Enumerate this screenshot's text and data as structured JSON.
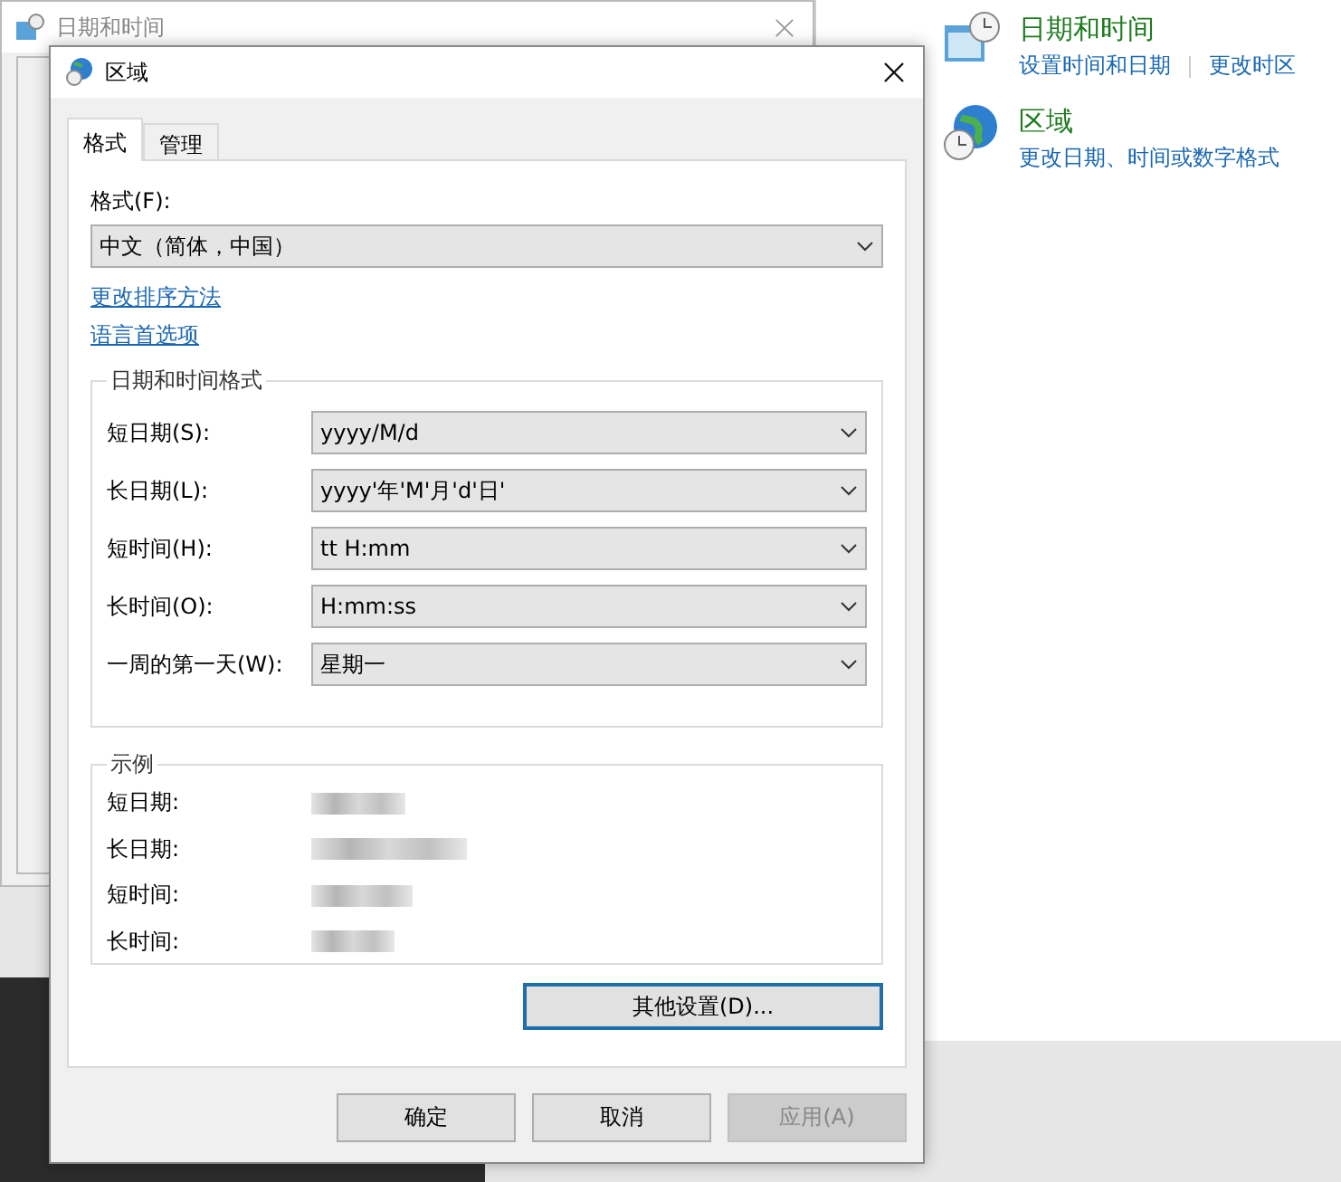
{
  "control_panel": {
    "items": [
      {
        "title": "日期和时间",
        "links": [
          "设置时间和日期",
          "更改时区"
        ]
      },
      {
        "title": "区域",
        "links": [
          "更改日期、时间或数字格式"
        ]
      }
    ]
  },
  "back_window": {
    "title": "日期和时间"
  },
  "dialog": {
    "title": "区域",
    "tabs": [
      {
        "label": "格式",
        "selected": true
      },
      {
        "label": "管理",
        "selected": false
      }
    ],
    "format_label": "格式(F):",
    "format_value": "中文（简体，中国）",
    "links": [
      "更改排序方法",
      "语言首选项"
    ],
    "datetime_group": {
      "title": "日期和时间格式",
      "rows": [
        {
          "label": "短日期(S):",
          "value": "yyyy/M/d"
        },
        {
          "label": "长日期(L):",
          "value": "yyyy'年'M'月'd'日'"
        },
        {
          "label": "短时间(H):",
          "value": "tt H:mm"
        },
        {
          "label": "长时间(O):",
          "value": "H:mm:ss"
        },
        {
          "label": "一周的第一天(W):",
          "value": "星期一"
        }
      ]
    },
    "sample_group": {
      "title": "示例",
      "rows": [
        {
          "label": "短日期:"
        },
        {
          "label": "长日期:"
        },
        {
          "label": "短时间:"
        },
        {
          "label": "长时间:"
        }
      ]
    },
    "more_button": "其他设置(D)...",
    "buttons": [
      {
        "label": "确定",
        "disabled": false
      },
      {
        "label": "取消",
        "disabled": false
      },
      {
        "label": "应用(A)",
        "disabled": true
      }
    ]
  }
}
